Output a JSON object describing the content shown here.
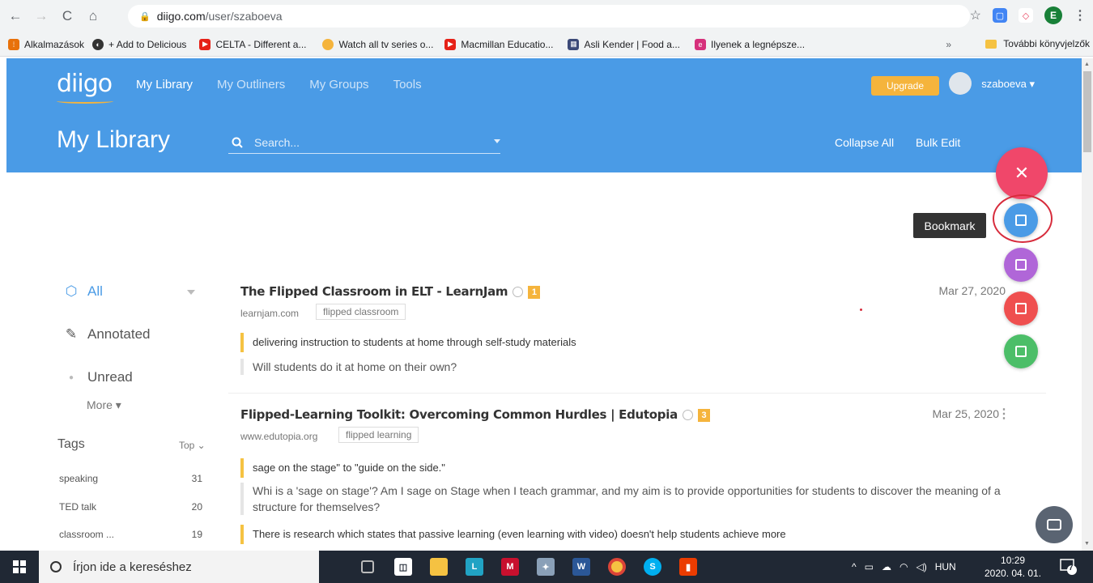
{
  "browser": {
    "url_domain": "diigo.com",
    "url_path": "/user/szaboeva",
    "profile_initial": "E"
  },
  "bookmarks_bar": [
    {
      "label": "Alkalmazások",
      "icon": "apps-grid-icon",
      "color": "#e8710a"
    },
    {
      "label": "+ Add to Delicious",
      "icon": "delicious-icon",
      "color": "#333333"
    },
    {
      "label": "CELTA - Different a...",
      "icon": "youtube-icon",
      "color": "#e62117"
    },
    {
      "label": "Watch all tv series o...",
      "icon": "tv-icon",
      "color": "#f5b43c"
    },
    {
      "label": "Macmillan Educatio...",
      "icon": "youtube-icon",
      "color": "#e62117"
    },
    {
      "label": "Asli Kender | Food a...",
      "icon": "grid-icon",
      "color": "#3c4a78"
    },
    {
      "label": "Ilyenek a legnépsze...",
      "icon": "e-icon",
      "color": "#d6307b"
    }
  ],
  "bookmarks_more": "»",
  "other_bookmarks": "További könyvjelzők",
  "header": {
    "logo": "diigo",
    "nav": [
      "My Library",
      "My Outliners",
      "My Groups",
      "Tools"
    ],
    "upgrade": "Upgrade",
    "username": "szaboeva ▾",
    "page_title": "My Library",
    "search_placeholder": "Search...",
    "collapse_all": "Collapse All",
    "bulk_edit": "Bulk Edit"
  },
  "sidebar": {
    "filters": [
      "All",
      "Annotated",
      "Unread"
    ],
    "more": "More ▾",
    "tags_title": "Tags",
    "tags_sort": "Top ⌄",
    "tags": [
      {
        "name": "speaking",
        "count": "31"
      },
      {
        "name": "TED talk",
        "count": "20"
      },
      {
        "name": "classroom ...",
        "count": "19"
      }
    ]
  },
  "items": [
    {
      "title": "The Flipped Classroom in ELT - LearnJam",
      "badge": "1",
      "domain": "learnjam.com",
      "tag": "flipped classroom",
      "date": "Mar 27, 2020",
      "highlight": "delivering instruction to students at home through self-study materials",
      "note": "Will students do it at home on their own?"
    },
    {
      "title": "Flipped-Learning Toolkit: Overcoming Common Hurdles | Edutopia",
      "badge": "3",
      "domain": "www.edutopia.org",
      "tag": "flipped learning",
      "date": "Mar 25, 2020",
      "highlight": "sage on the stage\" to \"guide on the side.\"",
      "note": "Whi is a 'sage on stage'? Am I sage on Stage when I teach grammar, and my aim is to provide opportunities for students to discover the meaning of a structure for themselves?",
      "highlight2": "There is research which states that passive learning (even learning with video) doesn't help students achieve more"
    }
  ],
  "fab": {
    "close": "✕",
    "tooltip": "Bookmark"
  },
  "taskbar": {
    "search_placeholder": "Írjon ide a kereséshez",
    "language": "HUN",
    "time": "10:29",
    "date": "2020. 04. 01.",
    "notifications": "7"
  }
}
